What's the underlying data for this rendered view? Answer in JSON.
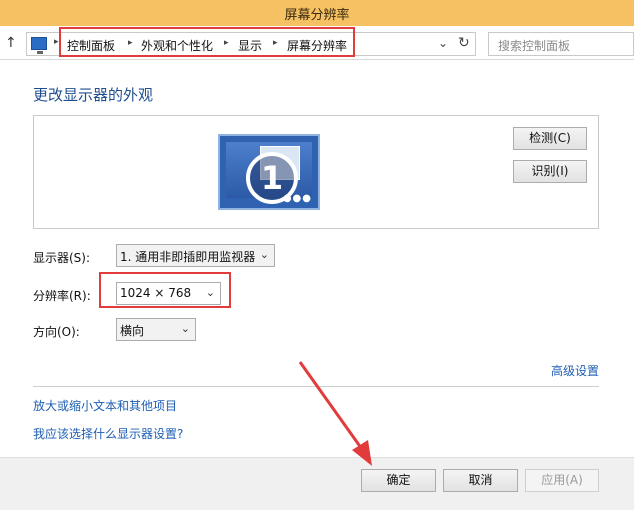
{
  "window": {
    "title": "屏幕分辨率"
  },
  "address": {
    "breadcrumbs": [
      "控制面板",
      "外观和个性化",
      "显示",
      "屏幕分辨率"
    ],
    "icons": {
      "up": "up-arrow-icon",
      "location": "monitor-icon",
      "dropdown": "chevron-down-icon",
      "refresh": "refresh-icon"
    }
  },
  "search": {
    "placeholder": "搜索控制面板"
  },
  "main": {
    "heading": "更改显示器的外观",
    "buttons": {
      "detect": "检测(C)",
      "identify": "识别(I)"
    },
    "monitor_number": "1",
    "fields": {
      "display": {
        "label": "显示器(S):",
        "value": "1. 通用非即插即用监视器"
      },
      "resolution": {
        "label": "分辨率(R):",
        "value": "1024 × 768"
      },
      "orientation": {
        "label": "方向(O):",
        "value": "横向"
      }
    },
    "advanced_link": "高级设置",
    "links": [
      "放大或缩小文本和其他项目",
      "我应该选择什么显示器设置?"
    ]
  },
  "footer": {
    "ok": "确定",
    "cancel": "取消",
    "apply": "应用(A)"
  },
  "colors": {
    "titlebar": "#f5c163",
    "annotation": "#e23b3b",
    "link": "#1e5fb3",
    "heading": "#1f4e8f"
  }
}
